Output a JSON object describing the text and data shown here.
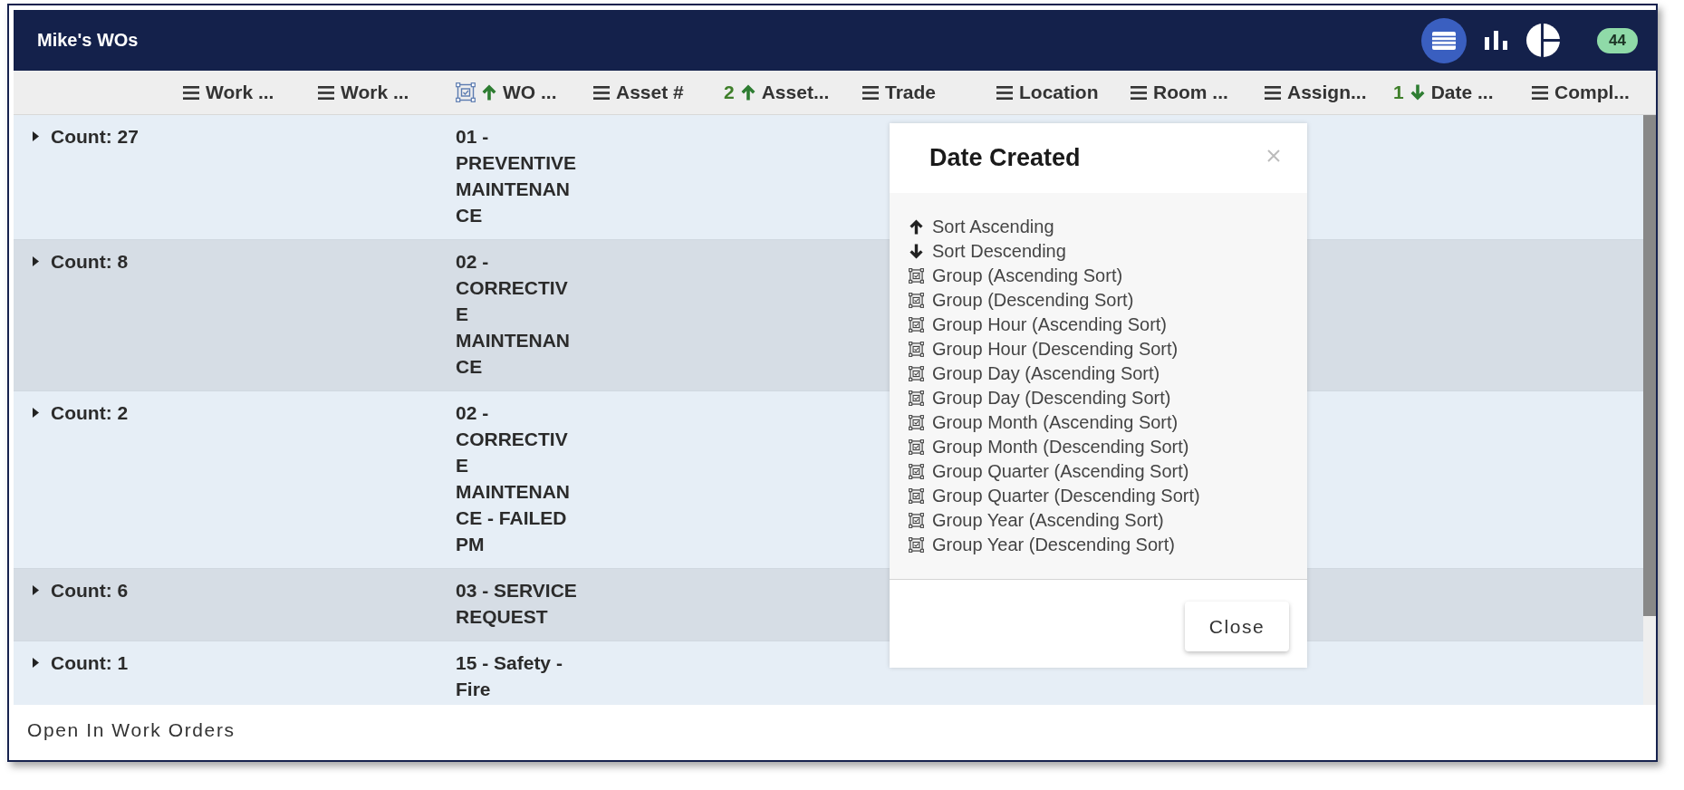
{
  "window": {
    "title": "Mike's WOs",
    "badge": "44"
  },
  "views": [
    {
      "kind": "table",
      "selected": true
    },
    {
      "kind": "bar",
      "selected": false
    },
    {
      "kind": "pie",
      "selected": false
    }
  ],
  "columns": [
    {
      "label": "Work ...",
      "sort_ascending": false,
      "sort_descending": false,
      "grouped": false
    },
    {
      "label": "Work ...",
      "sort_ascending": false,
      "sort_descending": false,
      "grouped": false
    },
    {
      "label": "WO ...",
      "sort_ascending": true,
      "sort_descending": false,
      "grouped": true
    },
    {
      "label": "Asset #",
      "sort_ascending": false,
      "sort_descending": false,
      "grouped": false
    },
    {
      "label": "Asset...",
      "sort_ascending": true,
      "sort_descending": false,
      "sort_order": "2",
      "grouped": false
    },
    {
      "label": "Trade",
      "sort_ascending": false,
      "sort_descending": false,
      "grouped": false
    },
    {
      "label": "Location",
      "sort_ascending": false,
      "sort_descending": false,
      "grouped": false
    },
    {
      "label": "Room ...",
      "sort_ascending": false,
      "sort_descending": false,
      "grouped": false
    },
    {
      "label": "Assign...",
      "sort_ascending": false,
      "sort_descending": false,
      "grouped": false
    },
    {
      "label": "Date ...",
      "sort_ascending": false,
      "sort_descending": true,
      "sort_order": "1",
      "grouped": false
    },
    {
      "label": "Compl...",
      "sort_ascending": false,
      "sort_descending": false,
      "grouped": false
    }
  ],
  "groups": [
    {
      "count": "Count: 27",
      "expanded": false,
      "value": "01 - PREVENTIVE MAINTENANCE"
    },
    {
      "count": "Count: 8",
      "expanded": false,
      "value": "02 - CORRECTIVE MAINTENANCE"
    },
    {
      "count": "Count: 2",
      "expanded": false,
      "value": "02 - CORRECTIVE MAINTENANCE - FAILED PM"
    },
    {
      "count": "Count: 6",
      "expanded": false,
      "value": "03 - SERVICE REQUEST"
    },
    {
      "count": "Count: 1",
      "expanded": false,
      "value": "15 - Safety - Fire"
    }
  ],
  "dialog": {
    "title": "Date Created",
    "options": [
      {
        "kind": "sort_asc",
        "label": "Sort Ascending"
      },
      {
        "kind": "sort_desc",
        "label": "Sort Descending"
      },
      {
        "kind": "group",
        "label": "Group (Ascending Sort)"
      },
      {
        "kind": "group",
        "label": "Group (Descending Sort)"
      },
      {
        "kind": "group",
        "label": "Group Hour (Ascending Sort)"
      },
      {
        "kind": "group",
        "label": "Group Hour (Descending Sort)"
      },
      {
        "kind": "group",
        "label": "Group Day (Ascending Sort)"
      },
      {
        "kind": "group",
        "label": "Group Day (Descending Sort)"
      },
      {
        "kind": "group",
        "label": "Group Month (Ascending Sort)"
      },
      {
        "kind": "group",
        "label": "Group Month (Descending Sort)"
      },
      {
        "kind": "group",
        "label": "Group Quarter (Ascending Sort)"
      },
      {
        "kind": "group",
        "label": "Group Quarter (Descending Sort)"
      },
      {
        "kind": "group",
        "label": "Group Year (Ascending Sort)"
      },
      {
        "kind": "group",
        "label": "Group Year (Descending Sort)"
      }
    ],
    "close_button": "Close"
  },
  "footer": {
    "link": "Open In Work Orders"
  }
}
